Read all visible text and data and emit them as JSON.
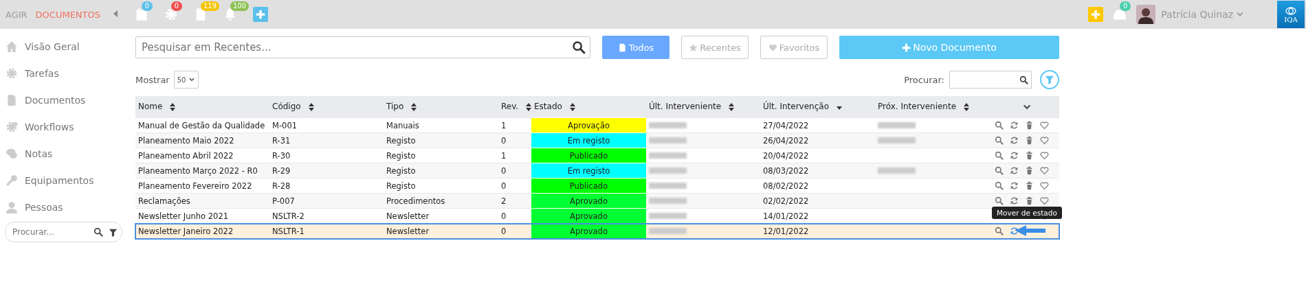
{
  "topbar": {
    "brand": [
      {
        "text": "AGIR",
        "highlighted": false
      },
      {
        "text": "DOCUMENTOS",
        "highlighted": true
      }
    ],
    "counters": [
      {
        "count": "0",
        "color": "#5bc0eb"
      },
      {
        "count": "0",
        "color": "#f0504f"
      },
      {
        "count": "119",
        "color": "#f5c400"
      },
      {
        "count": "100",
        "color": "#8cc152"
      }
    ],
    "right_inbox_count": "0",
    "user": {
      "name": "Patrícia Quinaz"
    },
    "logo": {
      "text": "IQA"
    }
  },
  "sidebar": {
    "items": [
      {
        "label": "Visão Geral"
      },
      {
        "label": "Tarefas"
      },
      {
        "label": "Documentos"
      },
      {
        "label": "Workflows"
      },
      {
        "label": "Notas"
      },
      {
        "label": "Equipamentos"
      },
      {
        "label": "Pessoas"
      }
    ],
    "search": {
      "placeholder": "Procurar..."
    }
  },
  "search": {
    "placeholder": "Pesquisar em Recentes..."
  },
  "filters": [
    {
      "label": "Todos",
      "selected": true
    },
    {
      "label": "Recentes",
      "selected": false
    },
    {
      "label": "Favoritos",
      "selected": false
    }
  ],
  "new_button": {
    "label": "Novo Documento"
  },
  "show": {
    "label": "Mostrar",
    "value": "50"
  },
  "table_search": {
    "label": "Procurar:"
  },
  "table": {
    "columns": [
      {
        "label": "Nome",
        "sorted": false
      },
      {
        "label": "Código",
        "sorted": false
      },
      {
        "label": "Tipo",
        "sorted": false
      },
      {
        "label": "Rev.",
        "sorted": false
      },
      {
        "label": "Estado",
        "sorted": false
      },
      {
        "label": "Últ. Interveniente",
        "sorted": false
      },
      {
        "label": "Últ. Intervenção",
        "sorted": true
      },
      {
        "label": "Próx. Interveniente",
        "sorted": false
      }
    ],
    "rows": [
      {
        "name": "Manual de Gestão da Qualidade",
        "code": "M-001",
        "type": "Manuais",
        "rev": "1",
        "state": {
          "label": "Aprovação",
          "color": "#ffff00"
        },
        "last_redacted": true,
        "date": "27/04/2022",
        "next_redacted": true,
        "selected": false
      },
      {
        "name": "Planeamento Maio 2022",
        "code": "R-31",
        "type": "Registo",
        "rev": "0",
        "state": {
          "label": "Em registo",
          "color": "#00ffff"
        },
        "last_redacted": true,
        "date": "26/04/2022",
        "next_redacted": true,
        "selected": false
      },
      {
        "name": "Planeamento Abril 2022",
        "code": "R-30",
        "type": "Registo",
        "rev": "1",
        "state": {
          "label": "Publicado",
          "color": "#00ff00"
        },
        "last_redacted": true,
        "date": "20/04/2022",
        "next_redacted": false,
        "selected": false
      },
      {
        "name": "Planeamento Março 2022 - R0",
        "code": "R-29",
        "type": "Registo",
        "rev": "0",
        "state": {
          "label": "Em registo",
          "color": "#00ffff"
        },
        "last_redacted": true,
        "date": "08/03/2022",
        "next_redacted": true,
        "selected": false
      },
      {
        "name": "Planeamento Fevereiro 2022",
        "code": "R-28",
        "type": "Registo",
        "rev": "0",
        "state": {
          "label": "Publicado",
          "color": "#00ff00"
        },
        "last_redacted": true,
        "date": "08/02/2022",
        "next_redacted": false,
        "selected": false
      },
      {
        "name": "Reclamações",
        "code": "P-007",
        "type": "Procedimentos",
        "rev": "2",
        "state": {
          "label": "Aprovado",
          "color": "#00ff33"
        },
        "last_redacted": true,
        "date": "02/02/2022",
        "next_redacted": false,
        "selected": false
      },
      {
        "name": "Newsletter Junho 2021",
        "code": "NSLTR-2",
        "type": "Newsletter",
        "rev": "0",
        "state": {
          "label": "Aprovado",
          "color": "#00ff33"
        },
        "last_redacted": true,
        "date": "14/01/2022",
        "next_redacted": false,
        "selected": false
      },
      {
        "name": "Newsletter Janeiro 2022",
        "code": "NSLTR-1",
        "type": "Newsletter",
        "rev": "0",
        "state": {
          "label": "Aprovado",
          "color": "#00ff33"
        },
        "last_redacted": true,
        "date": "12/01/2022",
        "next_redacted": false,
        "selected": true
      }
    ]
  },
  "tooltip": {
    "text": "Mover de estado"
  }
}
